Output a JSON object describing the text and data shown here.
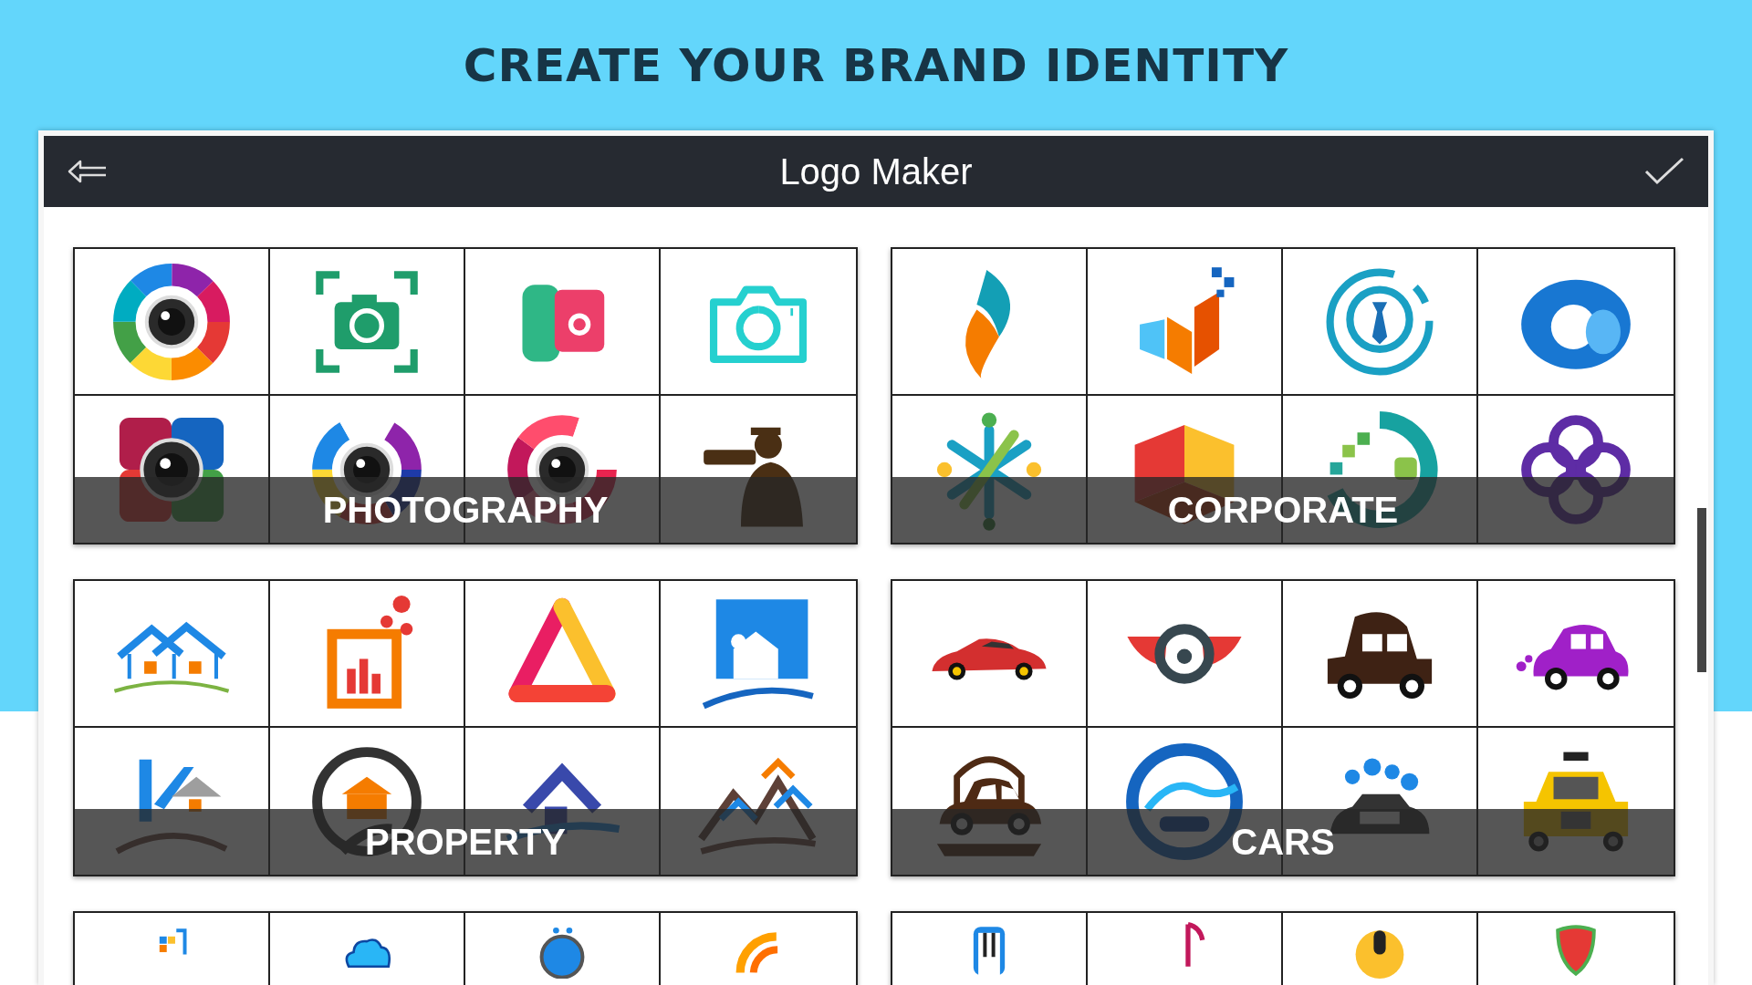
{
  "header": {
    "headline": "CREATE YOUR BRAND IDENTITY"
  },
  "app_bar": {
    "title": "Logo Maker"
  },
  "categories": [
    {
      "label": "PHOTOGRAPHY"
    },
    {
      "label": "CORPORATE"
    },
    {
      "label": "PROPERTY"
    },
    {
      "label": "CARS"
    }
  ]
}
